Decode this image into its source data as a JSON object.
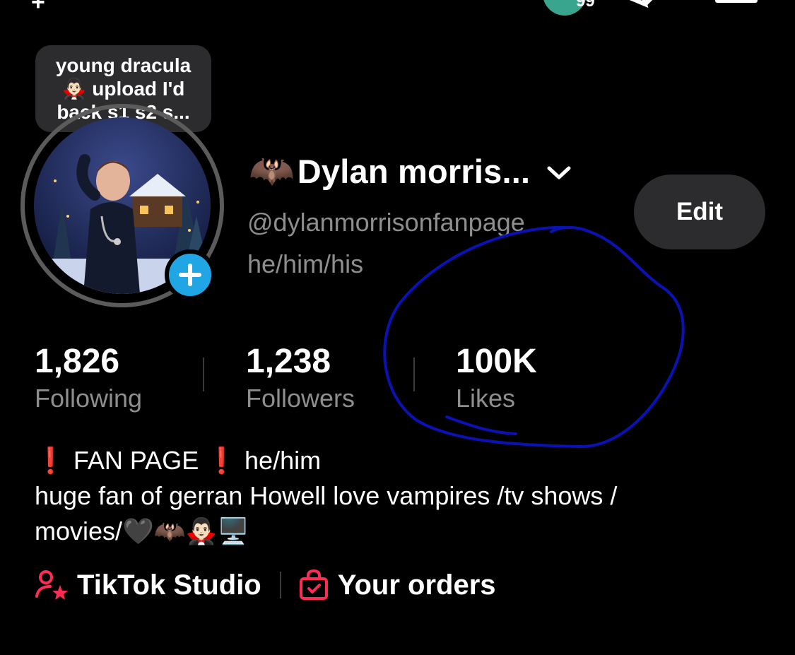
{
  "topbar": {
    "left_glyph": "+",
    "badge_count": "99"
  },
  "note_bubble": {
    "text": "young dracula 🧛🏻‍♂️ upload I'd back s1 s2 s..."
  },
  "profile": {
    "name_emoji": "🦇",
    "display_name": "Dylan morris...",
    "username": "@dylanmorrisonfanpage",
    "pronouns": "he/him/his",
    "edit_label": "Edit"
  },
  "stats": [
    {
      "value": "1,826",
      "label": "Following"
    },
    {
      "value": "1,238",
      "label": "Followers"
    },
    {
      "value": "100K",
      "label": "Likes"
    }
  ],
  "bio": {
    "lines": [
      "❗ FAN PAGE ❗ he/him",
      "huge fan of gerran Howell love vampires /tv shows /",
      "movies/🖤🦇🧛🏻‍♂️🖥️"
    ]
  },
  "links": [
    {
      "label": "TikTok Studio",
      "icon": "person-star-icon"
    },
    {
      "label": "Your orders",
      "icon": "shopping-bag-icon"
    }
  ],
  "colors": {
    "background": "#000000",
    "secondary_text": "#8e8e8e",
    "button_bg": "#2c2c2e",
    "add_button": "#20a6e4",
    "link_icon": "#fe2c55",
    "annotation": "#0a12b5"
  }
}
